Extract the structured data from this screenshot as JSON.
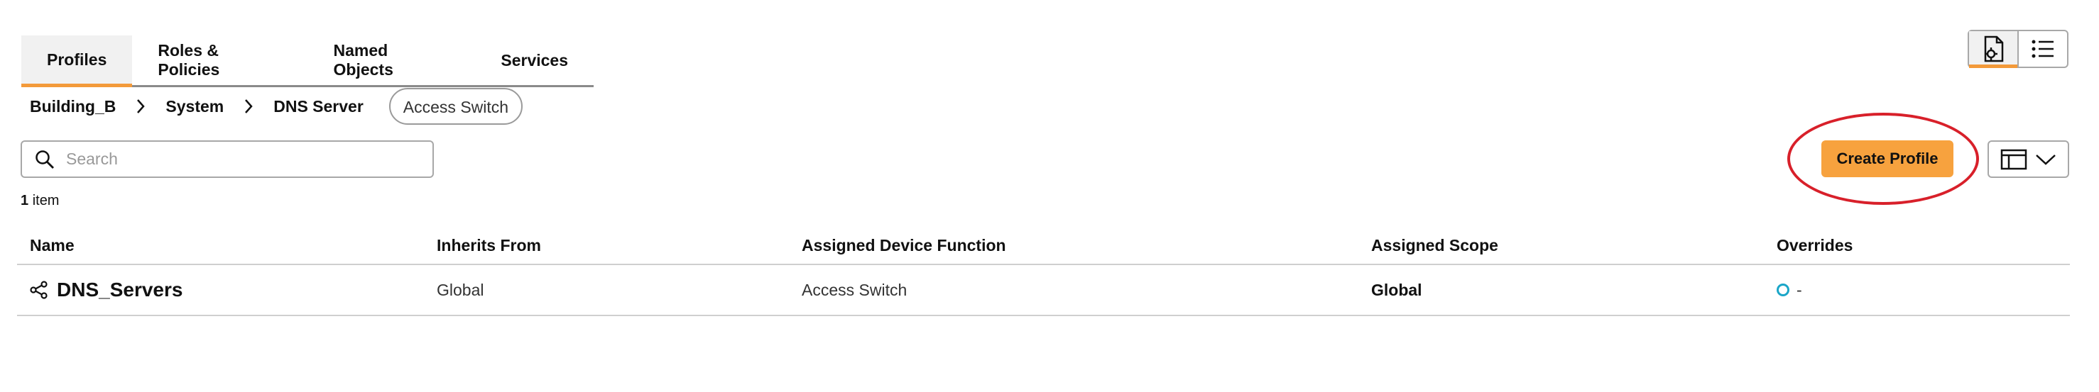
{
  "tabs": [
    {
      "label": "Profiles",
      "active": true
    },
    {
      "label": "Roles & Policies",
      "active": false
    },
    {
      "label": "Named Objects",
      "active": false
    },
    {
      "label": "Services",
      "active": false
    }
  ],
  "breadcrumb": {
    "items": [
      "Building_B",
      "System",
      "DNS Server"
    ],
    "pill": "Access Switch"
  },
  "search": {
    "placeholder": "Search",
    "value": ""
  },
  "item_count": {
    "number": "1",
    "label": "item"
  },
  "actions": {
    "create_label": "Create Profile"
  },
  "colors": {
    "accent": "#f7a23e",
    "highlight": "#d8202a",
    "override_circle": "#1aa6c8"
  },
  "table": {
    "headers": [
      "Name",
      "Inherits From",
      "Assigned Device Function",
      "Assigned Scope",
      "Overrides"
    ],
    "rows": [
      {
        "name": "DNS_Servers",
        "inherits_from": "Global",
        "device_function": "Access Switch",
        "scope": "Global",
        "overrides": "-"
      }
    ]
  },
  "icons": [
    "search-icon",
    "chevron-right-icon",
    "profile-settings-icon",
    "list-icon",
    "table-layout-icon",
    "chevron-down-icon",
    "share-icon",
    "status-circle-icon"
  ]
}
